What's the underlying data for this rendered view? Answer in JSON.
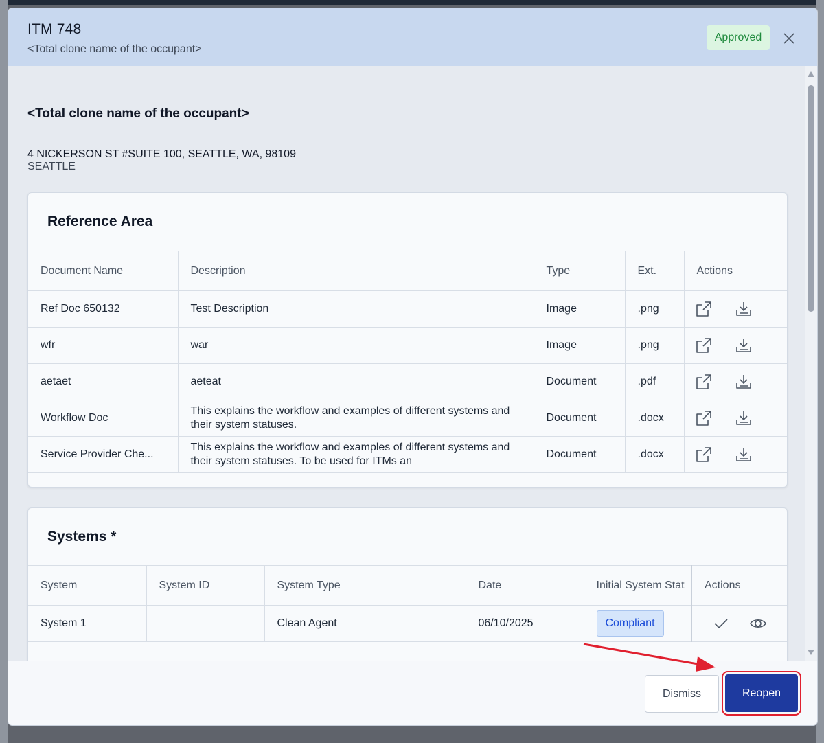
{
  "modal": {
    "title": "ITM 748",
    "subtitle": "<Total clone name of the occupant>",
    "status": "Approved",
    "close_icon": "close-icon"
  },
  "occupant": {
    "name": "<Total clone name of the occupant>",
    "address": "4 NICKERSON ST #SUITE 100, SEATTLE, WA, 98109",
    "city": "SEATTLE"
  },
  "reference_area": {
    "title": "Reference Area",
    "columns": [
      "Document Name",
      "Description",
      "Type",
      "Ext.",
      "Actions"
    ],
    "rows": [
      {
        "name": "Ref Doc 650132",
        "description": "Test Description",
        "type": "Image",
        "ext": ".png"
      },
      {
        "name": "wfr",
        "description": "war",
        "type": "Image",
        "ext": ".png"
      },
      {
        "name": "aetaet",
        "description": "aeteat",
        "type": "Document",
        "ext": ".pdf"
      },
      {
        "name": "Workflow Doc",
        "description": "This explains the workflow and examples of different systems and their system statuses.",
        "type": "Document",
        "ext": ".docx"
      },
      {
        "name": "Service Provider Che...",
        "description": "This explains the workflow and examples of different systems and their system statuses. To be used for ITMs an",
        "type": "Document",
        "ext": ".docx"
      }
    ],
    "row_icons": [
      "open-external-icon",
      "download-icon"
    ]
  },
  "systems": {
    "title": "Systems *",
    "columns": [
      "System",
      "System ID",
      "System Type",
      "Date",
      "Initial System Stat",
      "Actions"
    ],
    "rows": [
      {
        "system": "System 1",
        "system_id": "",
        "system_type": "Clean Agent",
        "date": "06/10/2025",
        "status": "Compliant"
      }
    ],
    "row_icons": [
      "check-icon",
      "eye-icon"
    ]
  },
  "footer": {
    "dismiss_label": "Dismiss",
    "reopen_label": "Reopen"
  },
  "colors": {
    "header_bg": "#c8d8ef",
    "approved_bg": "#dcf5e1",
    "approved_text": "#1f8a3d",
    "primary": "#1e3a9f",
    "annotation": "#e0202f"
  }
}
